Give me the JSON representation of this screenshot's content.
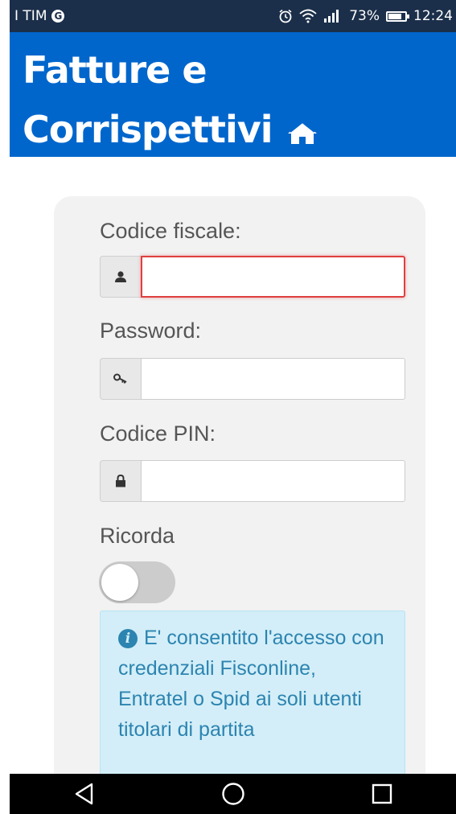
{
  "statusbar": {
    "carrier": "I TIM",
    "google_badge": "G",
    "battery_percent": "73%",
    "time": "12:24"
  },
  "header": {
    "title_line1": "Fatture e",
    "title_line2": "Corrispettivi"
  },
  "form": {
    "codice_fiscale_label": "Codice fiscale:",
    "codice_fiscale_value": "",
    "password_label": "Password:",
    "password_value": "",
    "pin_label": "Codice PIN:",
    "pin_value": "",
    "remember_label": "Ricorda",
    "remember_on": false
  },
  "info": {
    "text": "E' consentito l'accesso con credenziali Fisconline, Entratel o Spid ai soli utenti titolari di partita"
  },
  "icons": {
    "home": "home-icon",
    "user": "user-icon",
    "key": "key-icon",
    "lock": "lock-icon",
    "info": "info-icon",
    "back": "back-icon",
    "home_nav": "home-nav-icon",
    "recents": "recents-icon"
  },
  "colors": {
    "header_bg": "#0066cc",
    "statusbar_bg": "#1b2f4a",
    "error_border": "#e04040",
    "info_bg": "#d3eef8",
    "info_text": "#2c84b0"
  }
}
